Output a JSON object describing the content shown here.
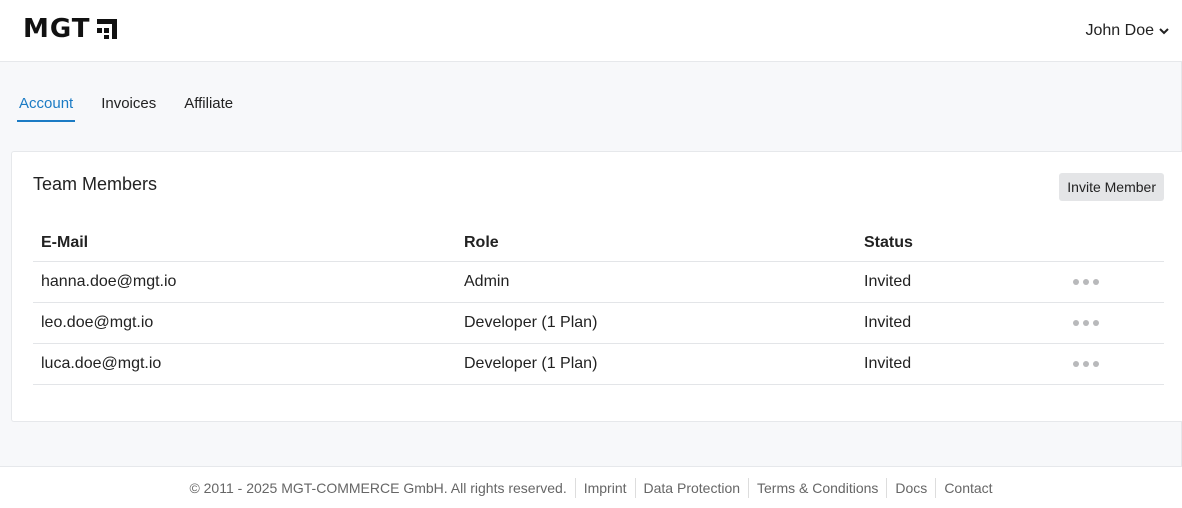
{
  "header": {
    "logo_text": "MGT",
    "user_name": "John Doe"
  },
  "tabs": [
    {
      "label": "Account",
      "active": true
    },
    {
      "label": "Invoices",
      "active": false
    },
    {
      "label": "Affiliate",
      "active": false
    }
  ],
  "team": {
    "title": "Team Members",
    "invite_label": "Invite Member",
    "columns": [
      "E-Mail",
      "Role",
      "Status"
    ],
    "rows": [
      {
        "email": "hanna.doe@mgt.io",
        "role": "Admin",
        "status": "Invited"
      },
      {
        "email": "leo.doe@mgt.io",
        "role": "Developer (1 Plan)",
        "status": "Invited"
      },
      {
        "email": "luca.doe@mgt.io",
        "role": "Developer (1 Plan)",
        "status": "Invited"
      }
    ]
  },
  "footer": {
    "copyright": "© 2011 - 2025 MGT-COMMERCE GmbH. All rights reserved.",
    "links": [
      "Imprint",
      "Data Protection",
      "Terms & Conditions",
      "Docs",
      "Contact"
    ]
  },
  "colors": {
    "accent": "#1b7bc4",
    "background": "#f7f8fa"
  }
}
